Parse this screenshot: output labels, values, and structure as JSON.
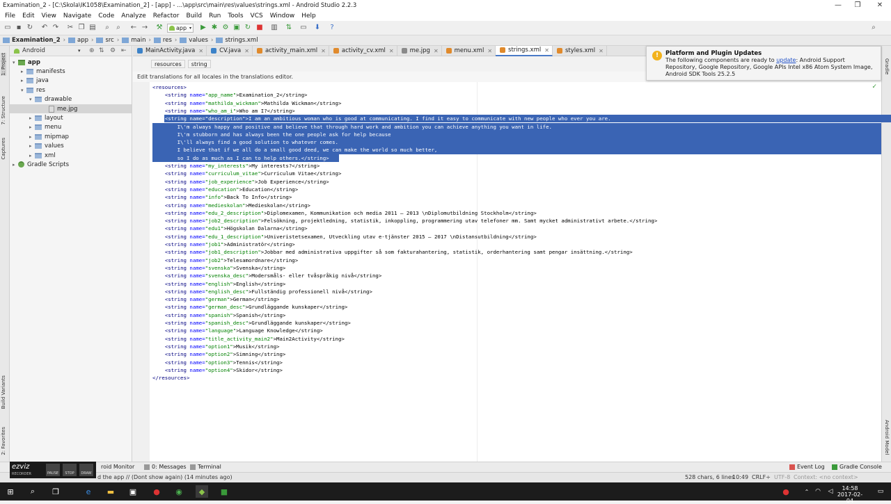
{
  "window": {
    "title": "Examination_2 - [C:\\Skola\\IK1058\\Examination_2] - [app] - ...\\app\\src\\main\\res\\values\\strings.xml - Android Studio 2.2.3",
    "minimize": "—",
    "restore": "❐",
    "close": "✕"
  },
  "menu": [
    "File",
    "Edit",
    "View",
    "Navigate",
    "Code",
    "Analyze",
    "Refactor",
    "Build",
    "Run",
    "Tools",
    "VCS",
    "Window",
    "Help"
  ],
  "toolbar": {
    "run_config": "app"
  },
  "breadcrumb": [
    "Examination_2",
    "app",
    "src",
    "main",
    "res",
    "values",
    "strings.xml"
  ],
  "project_panel": {
    "view_mode": "Android",
    "tree": [
      {
        "label": "app"
      },
      {
        "label": "manifests"
      },
      {
        "label": "java"
      },
      {
        "label": "res"
      },
      {
        "label": "drawable"
      },
      {
        "label": "me.jpg"
      },
      {
        "label": "layout"
      },
      {
        "label": "menu"
      },
      {
        "label": "mipmap"
      },
      {
        "label": "values"
      },
      {
        "label": "xml"
      },
      {
        "label": "Gradle Scripts"
      }
    ]
  },
  "left_strip": [
    "1: Project",
    "7: Structure",
    "Captures",
    "Build Variants",
    "2: Favorites"
  ],
  "right_strip": [
    "Gradle",
    "Android Model"
  ],
  "tabs": [
    {
      "label": "MainActivity.java",
      "color": "#3c82c8"
    },
    {
      "label": "CV.java",
      "color": "#3c82c8"
    },
    {
      "label": "activity_main.xml",
      "color": "#e08a2c"
    },
    {
      "label": "activity_cv.xml",
      "color": "#e08a2c"
    },
    {
      "label": "me.jpg",
      "color": "#8a8a8a"
    },
    {
      "label": "menu.xml",
      "color": "#e08a2c"
    },
    {
      "label": "strings.xml",
      "color": "#e08a2c"
    },
    {
      "label": "styles.xml",
      "color": "#e08a2c"
    }
  ],
  "editor": {
    "path_chips": [
      "resources",
      "string"
    ],
    "banner": "Edit translations for all locales in the translations editor.",
    "lines": [
      {
        "o": "<",
        "t": "resources",
        "c": ">"
      },
      {
        "i": "    ",
        "o": "<",
        "t": "string",
        "an": " name=",
        "av": "\"app_name\"",
        "tx": ">Examination_2</string>"
      },
      {
        "i": "    ",
        "o": "<",
        "t": "string",
        "an": " name=",
        "av": "\"mathilda_wickman\"",
        "tx": ">Mathilda Wickman</string>"
      },
      {
        "i": "    ",
        "o": "<",
        "t": "string",
        "an": " name=",
        "av": "\"who_am_i\"",
        "tx": ">Who am I?</string>"
      },
      {
        "i": "    ",
        "o": "<",
        "t": "string",
        "an": " name=",
        "av": "\"description\"",
        "tx": ">I am an ambitious woman who is good at communicating. I find it easy to communicate with new people who ever you are."
      },
      {
        "i": "",
        "o": "",
        "t": "",
        "an": "",
        "av": "",
        "tx": "        I\\'m always happy and positive and believe that through hard work and ambition you can achieve anything you want in life."
      },
      {
        "i": "",
        "o": "",
        "t": "",
        "an": "",
        "av": "",
        "tx": "        I\\'m stubborn and has always been the one people ask for help because"
      },
      {
        "i": "",
        "o": "",
        "t": "",
        "an": "",
        "av": "",
        "tx": "        I\\'ll always find a good solution to whatever comes."
      },
      {
        "i": "",
        "o": "",
        "t": "",
        "an": "",
        "av": "",
        "tx": "        I believe that if we all do a small good deed, we can make the world so much better,"
      },
      {
        "i": "",
        "o": "",
        "t": "",
        "an": "",
        "av": "",
        "tx": "        so I do as much as I can to help others.</string>"
      },
      {
        "i": "    ",
        "o": "<",
        "t": "string",
        "an": " name=",
        "av": "\"my_interests\"",
        "tx": ">My interests?</string>"
      },
      {
        "i": "    ",
        "o": "<",
        "t": "string",
        "an": " name=",
        "av": "\"curriculum_vitae\"",
        "tx": ">Curriculum Vitae</string>"
      },
      {
        "i": "    ",
        "o": "<",
        "t": "string",
        "an": " name=",
        "av": "\"job_experience\"",
        "tx": ">Job Experience</string>"
      },
      {
        "i": "    ",
        "o": "<",
        "t": "string",
        "an": " name=",
        "av": "\"education\"",
        "tx": ">Education</string>"
      },
      {
        "i": "    ",
        "o": "<",
        "t": "string",
        "an": " name=",
        "av": "\"info\"",
        "tx": ">Back To Info</string>"
      },
      {
        "i": "    ",
        "o": "<",
        "t": "string",
        "an": " name=",
        "av": "\"medieskolan\"",
        "tx": ">Medieskolan</string>"
      },
      {
        "i": "    ",
        "o": "<",
        "t": "string",
        "an": " name=",
        "av": "\"edu_2_description\"",
        "tx": ">Diplomexamen, Kommunikation och media 2011 – 2013 \\nDiplomutbildning Stockholm</string>"
      },
      {
        "i": "    ",
        "o": "<",
        "t": "string",
        "an": " name=",
        "av": "\"job2_description\"",
        "tx": ">Felsökning, projektledning, statistik, inkoppling, programmering utav telefoner mm. Samt mycket administrativt arbete.</string>"
      },
      {
        "i": "    ",
        "o": "<",
        "t": "string",
        "an": " name=",
        "av": "\"edu1\"",
        "tx": ">Högskolan Dalarna</string>"
      },
      {
        "i": "    ",
        "o": "<",
        "t": "string",
        "an": " name=",
        "av": "\"edu_1_description\"",
        "tx": ">Univeristetsexamen, Utveckling utav e-tjänster 2015 – 2017 \\nDistansutbildning</string>"
      },
      {
        "i": "    ",
        "o": "<",
        "t": "string",
        "an": " name=",
        "av": "\"job1\"",
        "tx": ">Administratör</string>"
      },
      {
        "i": "    ",
        "o": "<",
        "t": "string",
        "an": " name=",
        "av": "\"job1_description\"",
        "tx": ">Jobbar med administrativa uppgifter så som fakturahantering, statistik, orderhantering samt pengar insättning.</string>"
      },
      {
        "i": "    ",
        "o": "<",
        "t": "string",
        "an": " name=",
        "av": "\"job2\"",
        "tx": ">Telesamordnare</string>"
      },
      {
        "i": "    ",
        "o": "<",
        "t": "string",
        "an": " name=",
        "av": "\"svenska\"",
        "tx": ">Svenska</string>"
      },
      {
        "i": "    ",
        "o": "<",
        "t": "string",
        "an": " name=",
        "av": "\"svenska_desc\"",
        "tx": ">Modersmåls- eller tvåspråkig nivå</string>"
      },
      {
        "i": "    ",
        "o": "<",
        "t": "string",
        "an": " name=",
        "av": "\"english\"",
        "tx": ">English</string>"
      },
      {
        "i": "    ",
        "o": "<",
        "t": "string",
        "an": " name=",
        "av": "\"english_desc\"",
        "tx": ">Fullständig professionell nivå</string>"
      },
      {
        "i": "    ",
        "o": "<",
        "t": "string",
        "an": " name=",
        "av": "\"german\"",
        "tx": ">German</string>"
      },
      {
        "i": "    ",
        "o": "<",
        "t": "string",
        "an": " name=",
        "av": "\"german_desc\"",
        "tx": ">Grundläggande kunskaper</string>"
      },
      {
        "i": "    ",
        "o": "<",
        "t": "string",
        "an": " name=",
        "av": "\"spanish\"",
        "tx": ">Spanish</string>"
      },
      {
        "i": "    ",
        "o": "<",
        "t": "string",
        "an": " name=",
        "av": "\"spanish_desc\"",
        "tx": ">Grundläggande kunskaper</string>"
      },
      {
        "i": "    ",
        "o": "<",
        "t": "string",
        "an": " name=",
        "av": "\"language\"",
        "tx": ">Language Knowledge</string>"
      },
      {
        "i": "    ",
        "o": "<",
        "t": "string",
        "an": " name=",
        "av": "\"title_activity_main2\"",
        "tx": ">Main2Activity</string>"
      },
      {
        "i": "    ",
        "o": "<",
        "t": "string",
        "an": " name=",
        "av": "\"option1\"",
        "tx": ">Musik</string>"
      },
      {
        "i": "    ",
        "o": "<",
        "t": "string",
        "an": " name=",
        "av": "\"option2\"",
        "tx": ">Simning</string>"
      },
      {
        "i": "    ",
        "o": "<",
        "t": "string",
        "an": " name=",
        "av": "\"option3\"",
        "tx": ">Tennis</string>"
      },
      {
        "i": "    ",
        "o": "<",
        "t": "string",
        "an": " name=",
        "av": "\"option4\"",
        "tx": ">Skidor</string>"
      },
      {
        "o": "</",
        "t": "resources",
        "c": ">"
      }
    ]
  },
  "notification": {
    "title": "Platform and Plugin Updates",
    "body_pre": "The following components are ready to ",
    "link": "update",
    "body_post": ": Android Support Repository, Google Repository, Google APIs Intel x86 Atom System Image, Android SDK Tools 25.2.5"
  },
  "bottom_tools": {
    "monitor": "roid Monitor",
    "messages": "0: Messages",
    "terminal": "Terminal",
    "event_log": "Event Log",
    "gradle_console": "Gradle Console"
  },
  "ezviz": {
    "logo": "ezviz",
    "sub": "RECORDER",
    "buttons": [
      "PAUSE",
      "STOP",
      "DRAW"
    ]
  },
  "status": {
    "message": "d the app // (Dont show again) (14 minutes ago)",
    "chars": "528 chars, 6 lines",
    "position": "10:49",
    "line_sep": "CRLF÷",
    "encoding": "UTF-8",
    "context": "Context: <no context>"
  },
  "taskbar": {
    "time": "14:58",
    "date": "2017-02-04"
  }
}
